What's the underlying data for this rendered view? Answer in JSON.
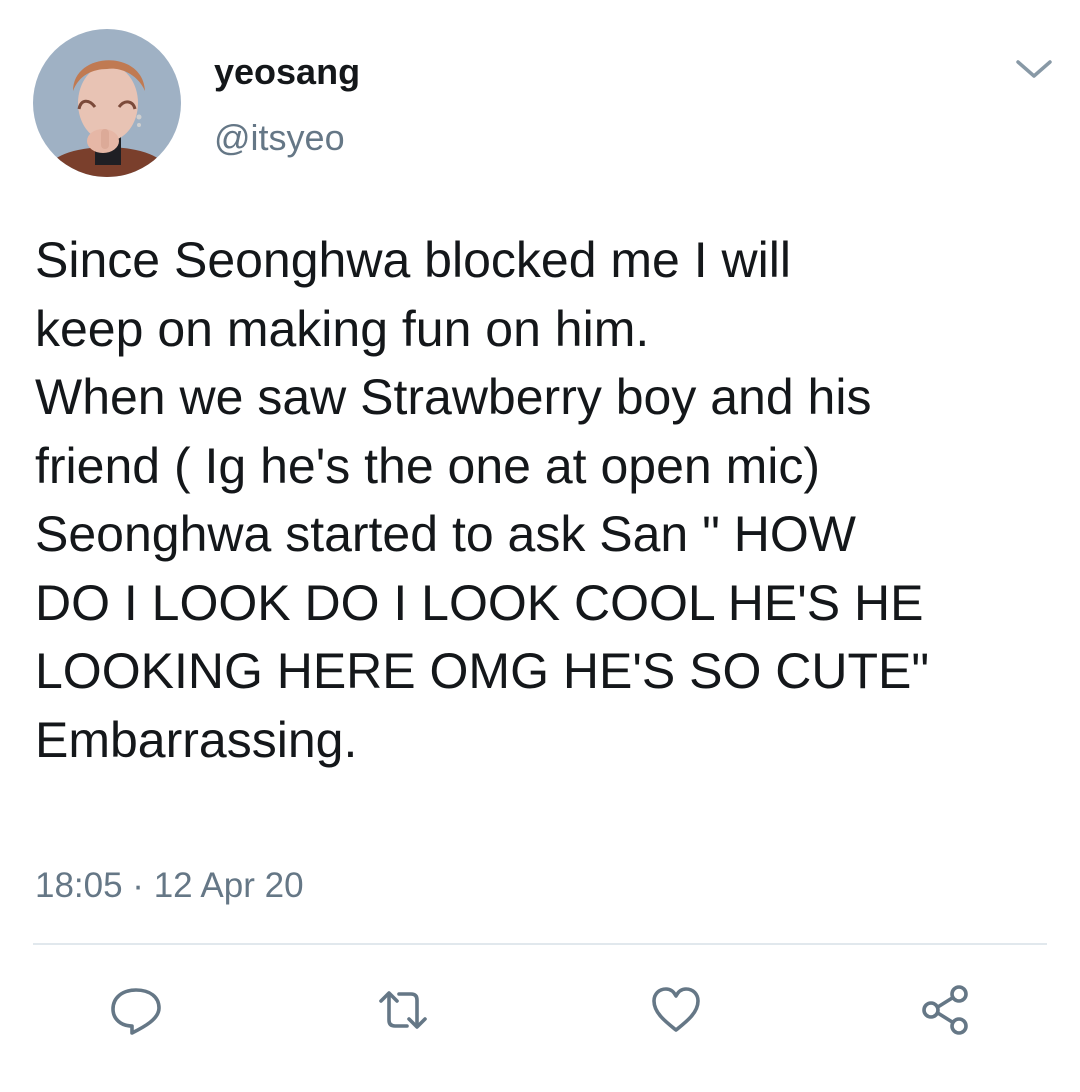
{
  "tweet": {
    "author": {
      "display_name": "yeosang",
      "handle": "@itsyeo"
    },
    "text": "Since Seonghwa blocked me I will\nkeep on making fun on him.\nWhen we saw Strawberry boy and his\nfriend ( Ig he's the one at open mic)\nSeonghwa started to ask San \" HOW\nDO I LOOK DO I LOOK COOL HE'S HE\nLOOKING HERE OMG HE'S SO CUTE\"\nEmbarrassing.",
    "timestamp": "18:05 · 12 Apr 20"
  },
  "icons": {
    "menu": "chevron-down-icon",
    "reply": "reply-icon",
    "retweet": "retweet-icon",
    "like": "heart-icon",
    "share": "share-icon"
  },
  "colors": {
    "text": "#14171a",
    "secondary": "#657786",
    "divider": "#e1e8ed",
    "icon": "#657786"
  }
}
